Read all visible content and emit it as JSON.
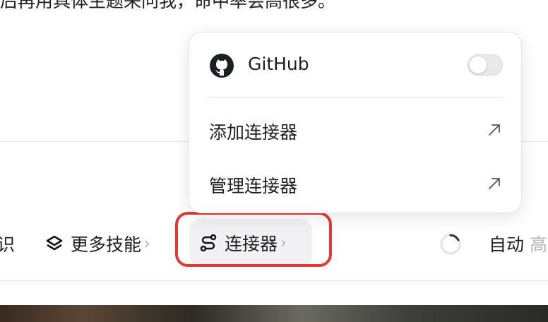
{
  "background": {
    "chat_text": "后再用具体主题来问我，命中率会高很多。"
  },
  "menu": {
    "items": [
      {
        "label": "GitHub",
        "icon": "github-icon",
        "toggle_on": false
      },
      {
        "label": "添加连接器",
        "icon": "arrow-up-right-icon"
      },
      {
        "label": "管理连接器",
        "icon": "arrow-up-right-icon"
      }
    ]
  },
  "toolbar": {
    "partial_left": "识",
    "more_skills": "更多技能",
    "connectors": "连接器",
    "mode": "自动",
    "partial_right": "高",
    "chevron": "›"
  },
  "colors": {
    "highlight": "#e53935",
    "button_bg": "#f1f1f3",
    "toggle_off": "#e9e9eb"
  }
}
